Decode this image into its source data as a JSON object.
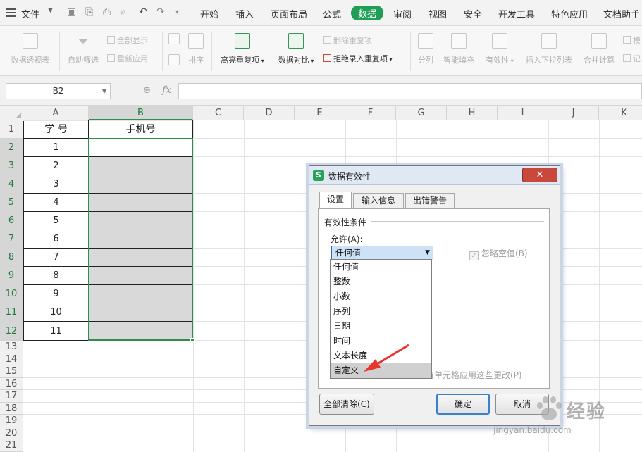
{
  "menubar": {
    "file_label": "文件",
    "tabs": [
      "开始",
      "插入",
      "页面布局",
      "公式",
      "数据",
      "审阅",
      "视图",
      "安全",
      "开发工具",
      "特色应用",
      "文档助手"
    ],
    "active_tab": "数据"
  },
  "ribbon": {
    "pivot": "数据透视表",
    "autofilter": "自动筛选",
    "show_all": "全部显示",
    "reapply": "重新应用",
    "sort": "排序",
    "highlight_dup": "高亮重复项",
    "compare": "数据对比",
    "delete_dup": "删除重复项",
    "reject_dup": "拒绝录入重复项",
    "split": "分列",
    "smart_fill": "智能填充",
    "validity": "有效性",
    "insert_dropdown": "插入下拉列表",
    "merge_calc": "合并计算",
    "cut_label_1": "模",
    "cut_label_2": "记"
  },
  "formula_bar": {
    "name_box": "B2",
    "fx": "fx",
    "formula": ""
  },
  "sheet": {
    "columns": [
      "A",
      "B",
      "C",
      "D",
      "E",
      "F",
      "G",
      "H",
      "I",
      "J",
      "K"
    ],
    "rows": [
      "1",
      "2",
      "3",
      "4",
      "5",
      "6",
      "7",
      "8",
      "9",
      "10",
      "11",
      "12",
      "13",
      "14",
      "15",
      "16",
      "17",
      "18",
      "19",
      "20",
      "21"
    ],
    "a1": "学  号",
    "b1": "手机号",
    "a_values": [
      "1",
      "2",
      "3",
      "4",
      "5",
      "6",
      "7",
      "8",
      "9",
      "10",
      "11"
    ]
  },
  "dialog": {
    "title": "数据有效性",
    "tabs": [
      "设置",
      "输入信息",
      "出错警告"
    ],
    "group_label": "有效性条件",
    "allow_label": "允许(A):",
    "allow_value": "任何值",
    "ignore_blank": "忽略空值(B)",
    "dropdown_options": [
      "任何值",
      "整数",
      "小数",
      "序列",
      "日期",
      "时间",
      "文本长度",
      "自定义"
    ],
    "highlighted_option": "自定义",
    "apply_all": "有单元格应用这些更改(P)",
    "clear_all": "全部清除(C)",
    "ok": "确定",
    "cancel": "取消"
  },
  "watermark": {
    "text": "经验",
    "url": "jingyan.baidu.com"
  },
  "colors": {
    "active_tab": "#1e9f55",
    "selection": "#2f8f4a",
    "arrow": "#e8352c",
    "dialog_close": "#c9483c"
  }
}
